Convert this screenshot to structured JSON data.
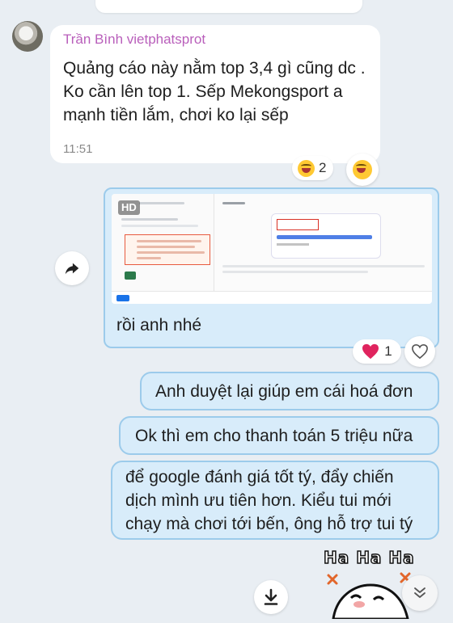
{
  "incoming_message": {
    "sender": "Trần Bình vietphatsprot",
    "text": "Quảng cáo này nằm top 3,4 gì cũng dc . Ko cần lên top 1. Sếp Mekongsport a mạnh tiền lắm, chơi ko lại sếp",
    "time": "11:51",
    "reaction": {
      "icon": "laughing-emoji-icon",
      "count": "2"
    }
  },
  "image_message": {
    "badge": "HD",
    "caption": "rồi anh nhé",
    "reaction": {
      "icon": "heart-icon",
      "count": "1"
    }
  },
  "outgoing_messages": [
    {
      "text": "Anh duyệt lại giúp em cái hoá đơn"
    },
    {
      "text": "Ok thì em cho thanh toán 5 triệu nữa"
    },
    {
      "lines": [
        "để google đánh giá tốt tý, đẩy chiến",
        "dịch mình ưu tiên hơn. Kiểu tui mới",
        "chạy mà chơi tới bến, ông hỗ trợ tui tý"
      ]
    }
  ],
  "sticker": {
    "text": "Ha Ha Ha"
  },
  "colors": {
    "sender_name": "#b95fbb",
    "bubble_out": "#d8ecfa",
    "bubble_border": "#9ccbeb",
    "background": "#e9eef3"
  }
}
